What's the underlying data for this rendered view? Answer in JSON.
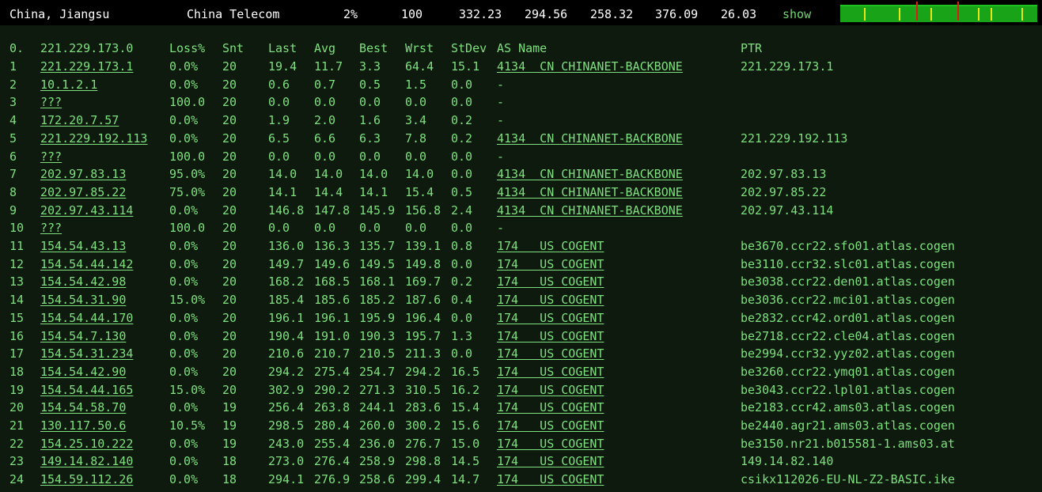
{
  "summary": {
    "location": "China, Jiangsu",
    "isp": "China Telecom",
    "loss": "2%",
    "sent": "100",
    "last": "332.23",
    "avg": "294.56",
    "best": "258.32",
    "worst": "376.09",
    "stdev": "26.03",
    "show_label": "show"
  },
  "colors": {
    "text": "#7ee07e",
    "background": "#0d1a0d",
    "sparkline": "#18a318",
    "marker_yellow": "#e6e619",
    "marker_red": "#e01818"
  },
  "header": {
    "index": "0.",
    "host": "221.229.173.0",
    "loss": "Loss%",
    "snt": "Snt",
    "last": "Last",
    "avg": "Avg",
    "best": "Best",
    "wrst": "Wrst",
    "stdev": "StDev",
    "asname": "AS Name",
    "ptr": "PTR"
  },
  "hops": [
    {
      "n": "1",
      "host": "221.229.173.1",
      "loss": "0.0%",
      "snt": "20",
      "last": "19.4",
      "avg": "11.7",
      "best": "3.3",
      "wrst": "64.4",
      "stdev": "15.1",
      "as": "4134  CN CHINANET-BACKBONE",
      "ptr": "221.229.173.1"
    },
    {
      "n": "2",
      "host": "10.1.2.1",
      "loss": "0.0%",
      "snt": "20",
      "last": "0.6",
      "avg": "0.7",
      "best": "0.5",
      "wrst": "1.5",
      "stdev": "0.0",
      "as": "-",
      "ptr": ""
    },
    {
      "n": "3",
      "host": "???",
      "loss": "100.0",
      "snt": "20",
      "last": "0.0",
      "avg": "0.0",
      "best": "0.0",
      "wrst": "0.0",
      "stdev": "0.0",
      "as": "-",
      "ptr": ""
    },
    {
      "n": "4",
      "host": "172.20.7.57",
      "loss": "0.0%",
      "snt": "20",
      "last": "1.9",
      "avg": "2.0",
      "best": "1.6",
      "wrst": "3.4",
      "stdev": "0.2",
      "as": "-",
      "ptr": ""
    },
    {
      "n": "5",
      "host": "221.229.192.113",
      "loss": "0.0%",
      "snt": "20",
      "last": "6.5",
      "avg": "6.6",
      "best": "6.3",
      "wrst": "7.8",
      "stdev": "0.2",
      "as": "4134  CN CHINANET-BACKBONE",
      "ptr": "221.229.192.113"
    },
    {
      "n": "6",
      "host": "???",
      "loss": "100.0",
      "snt": "20",
      "last": "0.0",
      "avg": "0.0",
      "best": "0.0",
      "wrst": "0.0",
      "stdev": "0.0",
      "as": "-",
      "ptr": ""
    },
    {
      "n": "7",
      "host": "202.97.83.13",
      "loss": "95.0%",
      "snt": "20",
      "last": "14.0",
      "avg": "14.0",
      "best": "14.0",
      "wrst": "14.0",
      "stdev": "0.0",
      "as": "4134  CN CHINANET-BACKBONE",
      "ptr": "202.97.83.13"
    },
    {
      "n": "8",
      "host": "202.97.85.22",
      "loss": "75.0%",
      "snt": "20",
      "last": "14.1",
      "avg": "14.4",
      "best": "14.1",
      "wrst": "15.4",
      "stdev": "0.5",
      "as": "4134  CN CHINANET-BACKBONE",
      "ptr": "202.97.85.22"
    },
    {
      "n": "9",
      "host": "202.97.43.114",
      "loss": "0.0%",
      "snt": "20",
      "last": "146.8",
      "avg": "147.8",
      "best": "145.9",
      "wrst": "156.8",
      "stdev": "2.4",
      "as": "4134  CN CHINANET-BACKBONE",
      "ptr": "202.97.43.114"
    },
    {
      "n": "10",
      "host": "???",
      "loss": "100.0",
      "snt": "20",
      "last": "0.0",
      "avg": "0.0",
      "best": "0.0",
      "wrst": "0.0",
      "stdev": "0.0",
      "as": "-",
      "ptr": ""
    },
    {
      "n": "11",
      "host": "154.54.43.13",
      "loss": "0.0%",
      "snt": "20",
      "last": "136.0",
      "avg": "136.3",
      "best": "135.7",
      "wrst": "139.1",
      "stdev": "0.8",
      "as": "174   US COGENT",
      "ptr": "be3670.ccr22.sfo01.atlas.cogen"
    },
    {
      "n": "12",
      "host": "154.54.44.142",
      "loss": "0.0%",
      "snt": "20",
      "last": "149.7",
      "avg": "149.6",
      "best": "149.5",
      "wrst": "149.8",
      "stdev": "0.0",
      "as": "174   US COGENT",
      "ptr": "be3110.ccr32.slc01.atlas.cogen"
    },
    {
      "n": "13",
      "host": "154.54.42.98",
      "loss": "0.0%",
      "snt": "20",
      "last": "168.2",
      "avg": "168.5",
      "best": "168.1",
      "wrst": "169.7",
      "stdev": "0.2",
      "as": "174   US COGENT",
      "ptr": "be3038.ccr22.den01.atlas.cogen"
    },
    {
      "n": "14",
      "host": "154.54.31.90",
      "loss": "15.0%",
      "snt": "20",
      "last": "185.4",
      "avg": "185.6",
      "best": "185.2",
      "wrst": "187.6",
      "stdev": "0.4",
      "as": "174   US COGENT",
      "ptr": "be3036.ccr22.mci01.atlas.cogen"
    },
    {
      "n": "15",
      "host": "154.54.44.170",
      "loss": "0.0%",
      "snt": "20",
      "last": "196.1",
      "avg": "196.1",
      "best": "195.9",
      "wrst": "196.4",
      "stdev": "0.0",
      "as": "174   US COGENT",
      "ptr": "be2832.ccr42.ord01.atlas.cogen"
    },
    {
      "n": "16",
      "host": "154.54.7.130",
      "loss": "0.0%",
      "snt": "20",
      "last": "190.4",
      "avg": "191.0",
      "best": "190.3",
      "wrst": "195.7",
      "stdev": "1.3",
      "as": "174   US COGENT",
      "ptr": "be2718.ccr22.cle04.atlas.cogen"
    },
    {
      "n": "17",
      "host": "154.54.31.234",
      "loss": "0.0%",
      "snt": "20",
      "last": "210.6",
      "avg": "210.7",
      "best": "210.5",
      "wrst": "211.3",
      "stdev": "0.0",
      "as": "174   US COGENT",
      "ptr": "be2994.ccr32.yyz02.atlas.cogen"
    },
    {
      "n": "18",
      "host": "154.54.42.90",
      "loss": "0.0%",
      "snt": "20",
      "last": "294.2",
      "avg": "275.4",
      "best": "254.7",
      "wrst": "294.2",
      "stdev": "16.5",
      "as": "174   US COGENT",
      "ptr": "be3260.ccr22.ymq01.atlas.cogen"
    },
    {
      "n": "19",
      "host": "154.54.44.165",
      "loss": "15.0%",
      "snt": "20",
      "last": "302.9",
      "avg": "290.2",
      "best": "271.3",
      "wrst": "310.5",
      "stdev": "16.2",
      "as": "174   US COGENT",
      "ptr": "be3043.ccr22.lpl01.atlas.cogen"
    },
    {
      "n": "20",
      "host": "154.54.58.70",
      "loss": "0.0%",
      "snt": "19",
      "last": "256.4",
      "avg": "263.8",
      "best": "244.1",
      "wrst": "283.6",
      "stdev": "15.4",
      "as": "174   US COGENT",
      "ptr": "be2183.ccr42.ams03.atlas.cogen"
    },
    {
      "n": "21",
      "host": "130.117.50.6",
      "loss": "10.5%",
      "snt": "19",
      "last": "298.5",
      "avg": "280.4",
      "best": "260.0",
      "wrst": "300.2",
      "stdev": "15.6",
      "as": "174   US COGENT",
      "ptr": "be2440.agr21.ams03.atlas.cogen"
    },
    {
      "n": "22",
      "host": "154.25.10.222",
      "loss": "0.0%",
      "snt": "19",
      "last": "243.0",
      "avg": "255.4",
      "best": "236.0",
      "wrst": "276.7",
      "stdev": "15.0",
      "as": "174   US COGENT",
      "ptr": "be3150.nr21.b015581-1.ams03.at"
    },
    {
      "n": "23",
      "host": "149.14.82.140",
      "loss": "0.0%",
      "snt": "18",
      "last": "273.0",
      "avg": "276.4",
      "best": "258.9",
      "wrst": "298.8",
      "stdev": "14.5",
      "as": "174   US COGENT",
      "ptr": "149.14.82.140"
    },
    {
      "n": "24",
      "host": "154.59.112.26",
      "loss": "0.0%",
      "snt": "18",
      "last": "294.1",
      "avg": "276.9",
      "best": "258.6",
      "wrst": "299.4",
      "stdev": "14.7",
      "as": "174   US COGENT",
      "ptr": "csikx112026-EU-NL-Z2-BASIC.ike"
    }
  ]
}
